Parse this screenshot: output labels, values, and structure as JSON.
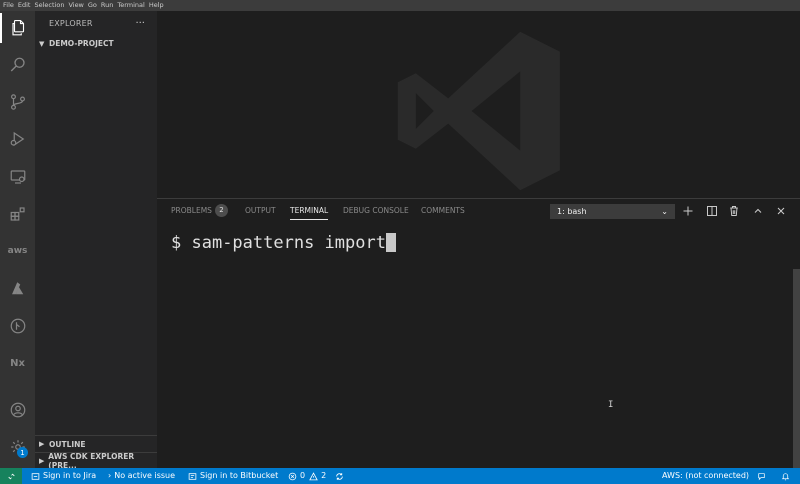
{
  "menu": [
    "File",
    "Edit",
    "Selection",
    "View",
    "Go",
    "Run",
    "Terminal",
    "Help"
  ],
  "activity": {
    "icons": [
      "explorer-icon",
      "search-icon",
      "source-control-icon",
      "run-debug-icon",
      "remote-explorer-icon",
      "extensions-icon",
      "aws-icon",
      "azure-icon",
      "gitlens-icon",
      "nx-icon",
      "account-icon",
      "settings-gear-icon"
    ],
    "aws_label": "aws",
    "nx_label": "Nx",
    "settings_badge": "1"
  },
  "sidebar": {
    "title": "EXPLORER",
    "more": "···",
    "project": "DEMO-PROJECT",
    "outline": "OUTLINE",
    "cdk": "AWS CDK EXPLORER (PRE..."
  },
  "panel": {
    "tabs": {
      "problems": "PROBLEMS",
      "problems_count": "2",
      "output": "OUTPUT",
      "terminal": "TERMINAL",
      "debug": "DEBUG CONSOLE",
      "comments": "COMMENTS"
    },
    "terminal_select": "1: bash",
    "actions": [
      "add-terminal-icon",
      "split-terminal-icon",
      "kill-terminal-icon",
      "maximize-panel-icon",
      "close-panel-icon"
    ]
  },
  "terminal": {
    "prompt": "$ ",
    "command": "sam-patterns import"
  },
  "statusbar": {
    "remote_icon": "remote-icon",
    "jira": "Sign in to Jira",
    "issue": "No active issue",
    "bitbucket": "Sign in to Bitbucket",
    "errors": "0",
    "warnings": "2",
    "aws": "AWS: (not connected)"
  },
  "colors": {
    "statusbar": "#007acc",
    "remote": "#16825d",
    "activitybar": "#333333",
    "sidebar": "#252526",
    "editor": "#1e1e1e"
  }
}
